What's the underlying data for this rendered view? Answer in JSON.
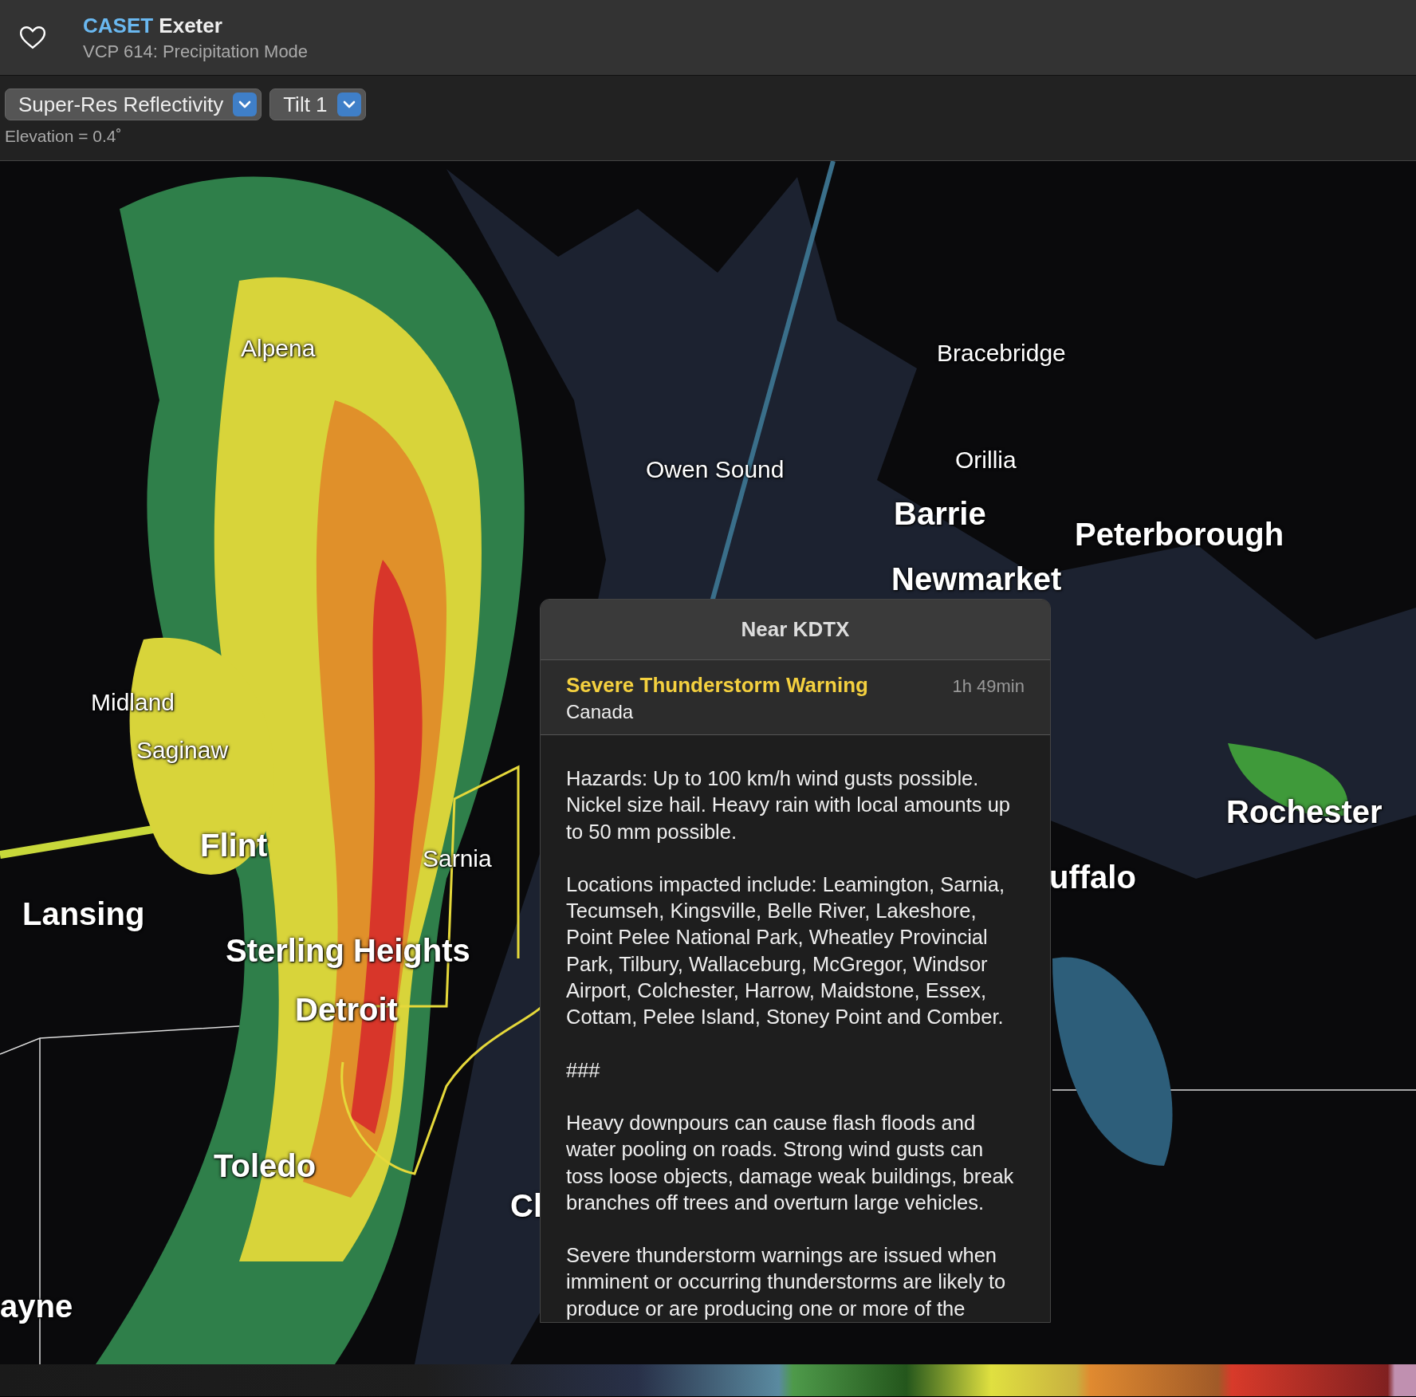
{
  "header": {
    "source": "CASET",
    "station": "Exeter",
    "subtitle": "VCP 614: Precipitation Mode"
  },
  "controls": {
    "dropdowns": [
      {
        "label": "Super-Res Reflectivity"
      },
      {
        "label": "Tilt 1"
      }
    ],
    "elevation": "Elevation = 0.4˚"
  },
  "map": {
    "labels": [
      {
        "text": "Alpena",
        "kind": "minor"
      },
      {
        "text": "Bracebridge",
        "kind": "minor"
      },
      {
        "text": "Owen Sound",
        "kind": "minor"
      },
      {
        "text": "Orillia",
        "kind": "minor"
      },
      {
        "text": "Barrie",
        "kind": "major"
      },
      {
        "text": "Peterborough",
        "kind": "major"
      },
      {
        "text": "Newmarket",
        "kind": "major"
      },
      {
        "text": "Midland",
        "kind": "minor"
      },
      {
        "text": "Saginaw",
        "kind": "minor"
      },
      {
        "text": "Flint",
        "kind": "major"
      },
      {
        "text": "Sarnia",
        "kind": "minor"
      },
      {
        "text": "Lansing",
        "kind": "major"
      },
      {
        "text": "Sterling Heights",
        "kind": "major"
      },
      {
        "text": "Detroit",
        "kind": "major"
      },
      {
        "text": "Toledo",
        "kind": "major"
      },
      {
        "text": "Cl",
        "kind": "major"
      },
      {
        "text": "ayne",
        "kind": "major"
      },
      {
        "text": "Rochester",
        "kind": "major"
      },
      {
        "text": "uffalo",
        "kind": "major"
      }
    ]
  },
  "popup": {
    "title": "Near KDTX",
    "alerts": [
      {
        "title": "Severe Thunderstorm Warning",
        "area": "Canada",
        "time": "1h 49min"
      }
    ],
    "paragraphs": [
      "Hazards: Up to 100 km/h wind gusts possible. Nickel size hail. Heavy rain with local amounts up to 50 mm possible.",
      "Locations impacted include: Leamington, Sarnia, Tecumseh, Kingsville, Belle River, Lakeshore, Point Pelee National Park, Wheatley Provincial Park, Tilbury, Wallaceburg, McGregor, Windsor Airport, Colchester, Harrow, Maidstone, Essex, Cottam, Pelee Island, Stoney Point and Comber.",
      "###",
      "Heavy downpours can cause flash floods and water pooling on roads. Strong wind gusts can toss loose objects, damage weak buildings, break branches off trees and overturn large vehicles.",
      "Severe thunderstorm warnings are issued when imminent or occurring thunderstorms are likely to produce or are producing one or more of the"
    ]
  }
}
